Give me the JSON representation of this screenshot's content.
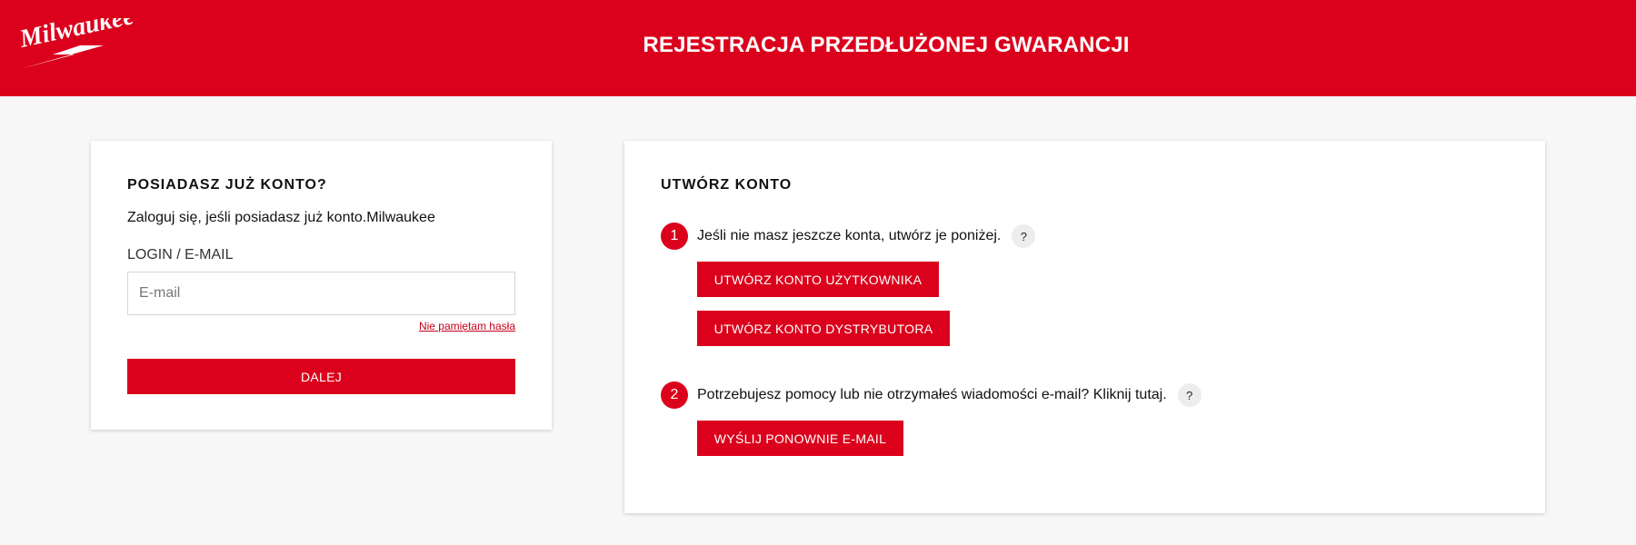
{
  "brand": {
    "logo_text": "Milwaukee",
    "accent_color": "#db011c"
  },
  "header": {
    "title": "REJESTRACJA PRZEDŁUŻONEJ GWARANCJI"
  },
  "login": {
    "heading": "POSIADASZ JUŻ KONTO?",
    "description": "Zaloguj się, jeśli posiadasz już konto.Milwaukee",
    "field_label": "LOGIN / E-MAIL",
    "email_value": "",
    "email_placeholder": "E-mail",
    "forgot_label": "Nie pamiętam hasła",
    "next_label": "DALEJ"
  },
  "create": {
    "heading": "UTWÓRZ KONTO",
    "step1": {
      "number": "1",
      "text": "Jeśli nie masz jeszcze konta, utwórz je poniżej.",
      "help": "?",
      "user_button_label": "UTWÓRZ KONTO UŻYTKOWNIKA",
      "distributor_button_label": "UTWÓRZ KONTO DYSTRYBUTORA"
    },
    "step2": {
      "number": "2",
      "text": "Potrzebujesz pomocy lub nie otrzymałeś wiadomości e-mail? Kliknij tutaj.",
      "help": "?",
      "resend_button_label": "WYŚLIJ PONOWNIE E-MAIL"
    }
  }
}
